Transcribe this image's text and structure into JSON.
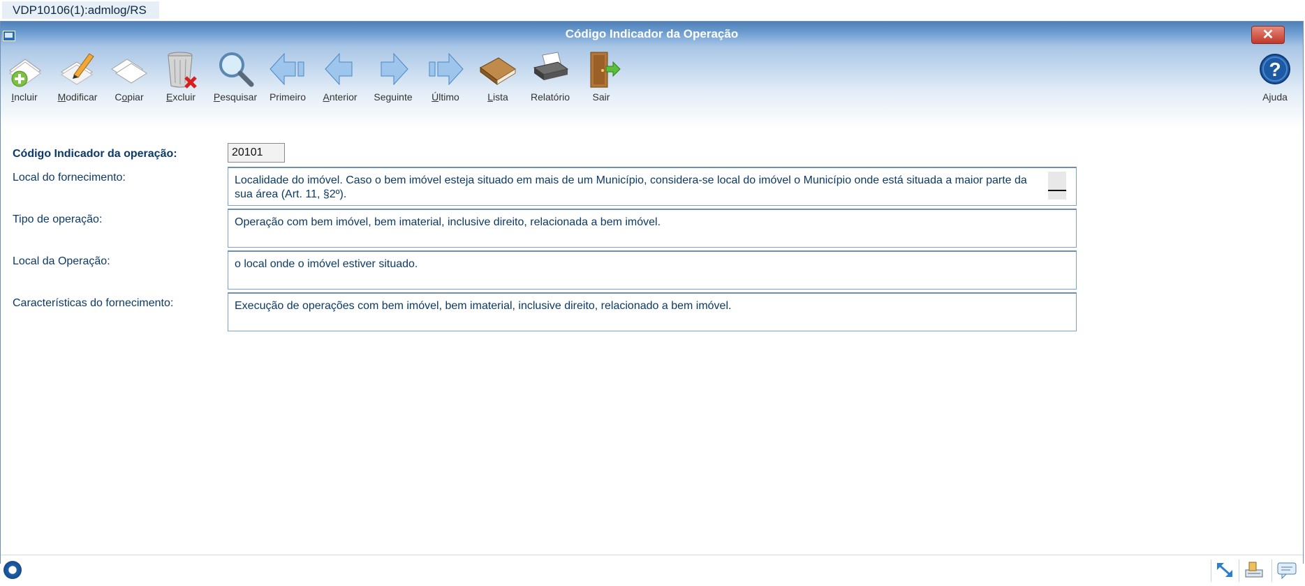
{
  "session": {
    "tab": "VDP10106(1):admlog/RS"
  },
  "window": {
    "title": "Código Indicador da Operação",
    "close": "✕"
  },
  "toolbar": [
    {
      "name": "incluir",
      "ul": "I",
      "rest": "ncluir"
    },
    {
      "name": "modificar",
      "ul": "M",
      "rest": "odificar"
    },
    {
      "name": "copiar",
      "ul": "",
      "pre": "C",
      "ul2": "o",
      "rest": "piar"
    },
    {
      "name": "excluir",
      "ul": "E",
      "rest": "xcluir"
    },
    {
      "name": "pesquisar",
      "ul": "P",
      "rest": "esquisar"
    },
    {
      "name": "primeiro",
      "ul": "",
      "rest": "Primeiro"
    },
    {
      "name": "anterior",
      "ul": "A",
      "rest": "nterior"
    },
    {
      "name": "seguinte",
      "ul": "",
      "pre": "Se",
      "ul2": "g",
      "rest": "uinte"
    },
    {
      "name": "ultimo",
      "ul": "Ú",
      "rest": "ltimo"
    },
    {
      "name": "lista",
      "ul": "L",
      "rest": "ista"
    },
    {
      "name": "relatorio",
      "ul": "",
      "rest": "Relatório"
    },
    {
      "name": "sair",
      "ul": "",
      "rest": "Sair"
    }
  ],
  "help": {
    "label": "Ajuda"
  },
  "form": {
    "codigo_label": "Código Indicador da operação:",
    "codigo_value": "20101",
    "local_fornecimento_label": "Local do fornecimento:",
    "local_fornecimento_value": "Localidade do imóvel. Caso o bem imóvel esteja situado em mais de um Município, considera-se local do imóvel o Município onde está situada a maior parte da sua área (Art. 11, §2º).",
    "tipo_operacao_label": "Tipo de operação:",
    "tipo_operacao_value": "Operação com bem imóvel, bem imaterial, inclusive direito,  relacionada a bem imóvel.",
    "local_operacao_label": "Local da Operação:",
    "local_operacao_value": "o local onde o imóvel estiver situado.",
    "caracteristicas_label": "Características do fornecimento:",
    "caracteristicas_value": "Execução de operações com bem imóvel, bem imaterial, inclusive direito, relacionado a bem imóvel."
  }
}
